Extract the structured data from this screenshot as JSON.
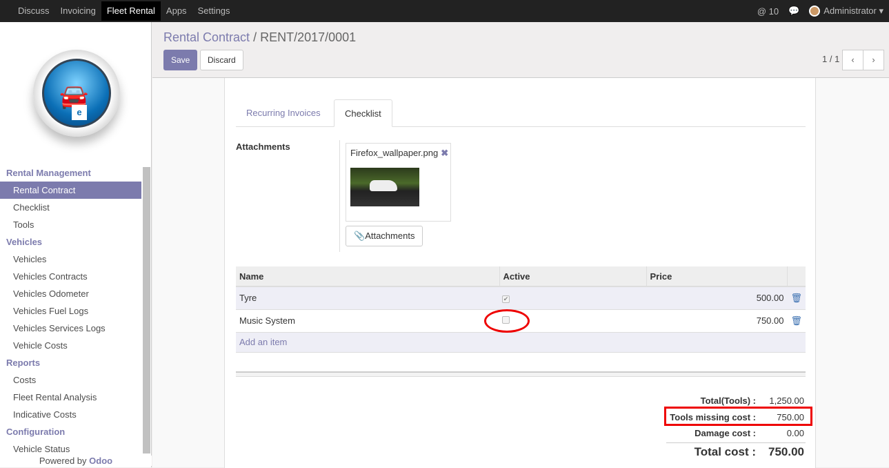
{
  "topbar": {
    "menus": [
      "Discuss",
      "Invoicing",
      "Fleet Rental",
      "Apps",
      "Settings"
    ],
    "mentions": "@ 10",
    "user": "Administrator"
  },
  "sidebar": {
    "sections": [
      {
        "title": "Rental Management",
        "items": [
          "Rental Contract",
          "Checklist",
          "Tools"
        ]
      },
      {
        "title": "Vehicles",
        "items": [
          "Vehicles",
          "Vehicles Contracts",
          "Vehicles Odometer",
          "Vehicles Fuel Logs",
          "Vehicles Services Logs",
          "Vehicle Costs"
        ]
      },
      {
        "title": "Reports",
        "items": [
          "Costs",
          "Fleet Rental Analysis",
          "Indicative Costs"
        ]
      },
      {
        "title": "Configuration",
        "items": [
          "Vehicle Status"
        ]
      }
    ],
    "powered": "Powered by ",
    "brand": "Odoo"
  },
  "breadcrumb": {
    "parent": "Rental Contract",
    "sep": " / ",
    "current": "RENT/2017/0001"
  },
  "buttons": {
    "save": "Save",
    "discard": "Discard"
  },
  "pager": "1 / 1",
  "tabs": [
    "Recurring Invoices",
    "Checklist"
  ],
  "attachments": {
    "label": "Attachments",
    "file": "Firefox_wallpaper.png",
    "button": "Attachments"
  },
  "table": {
    "headers": [
      "Name",
      "Active",
      "Price"
    ],
    "rows": [
      {
        "name": "Tyre",
        "active": true,
        "price": "500.00"
      },
      {
        "name": "Music System",
        "active": false,
        "price": "750.00"
      }
    ],
    "add": "Add an item"
  },
  "totals": {
    "tools_label": "Total(Tools) :",
    "tools": "1,250.00",
    "missing_label": "Tools missing cost :",
    "missing": "750.00",
    "damage_label": "Damage cost :",
    "damage": "0.00",
    "total_label": "Total cost :",
    "total": "750.00"
  }
}
